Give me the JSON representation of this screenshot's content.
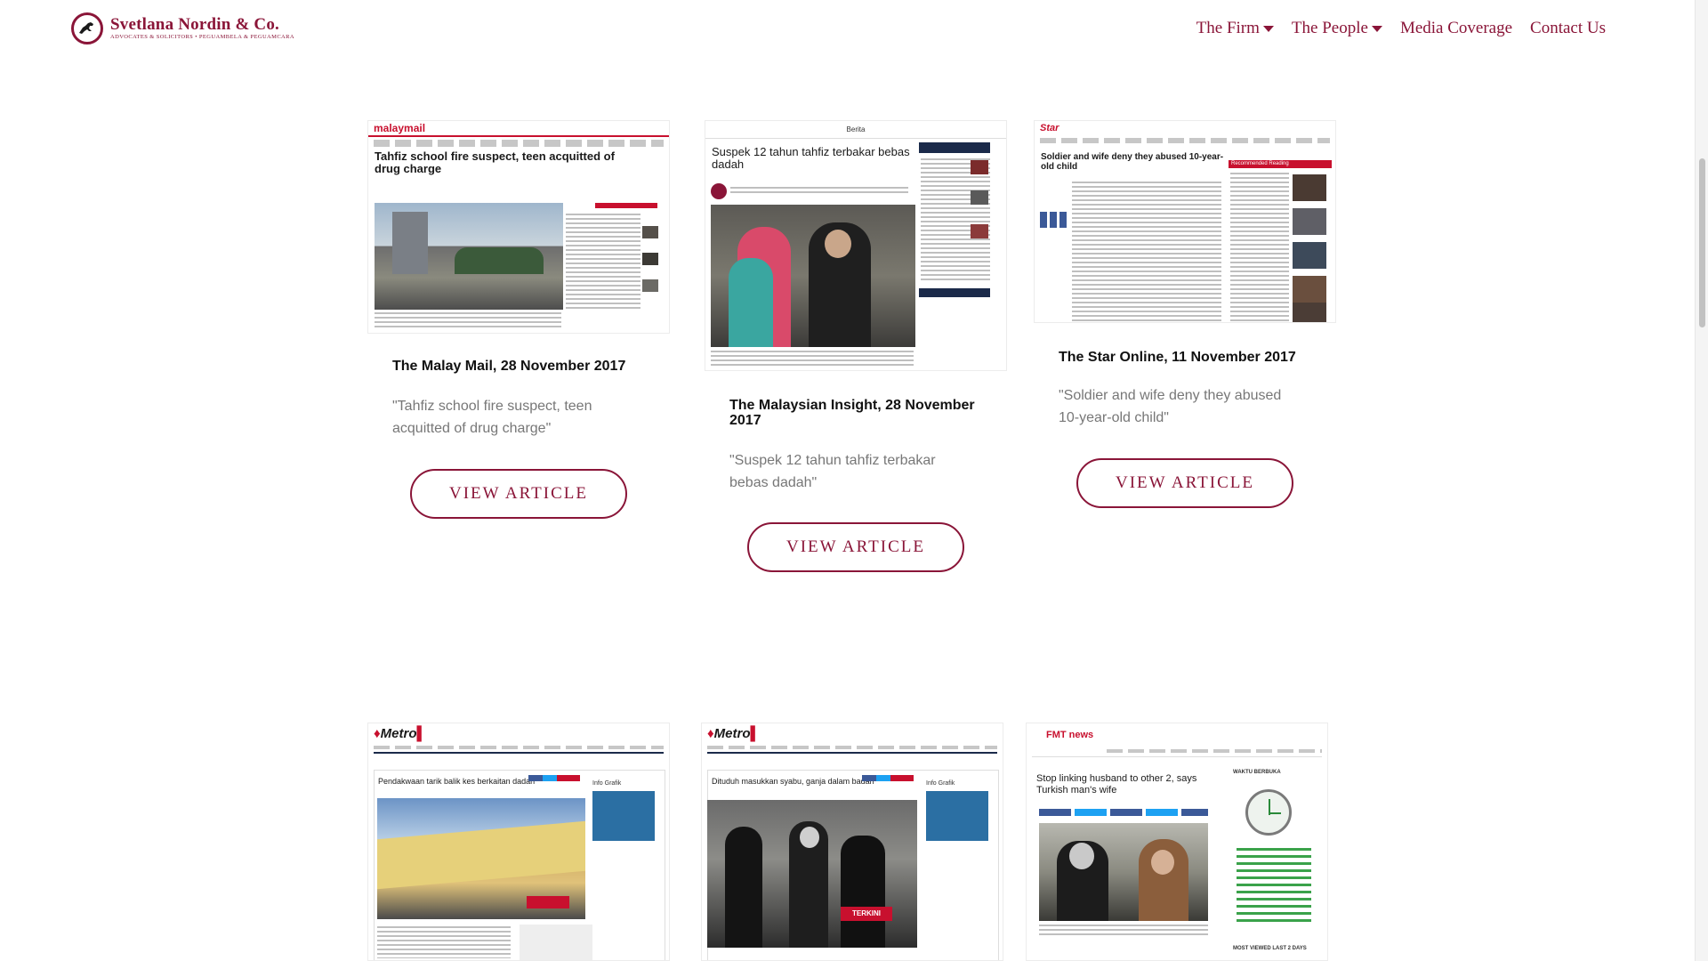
{
  "header": {
    "logo": {
      "name": "Svetlana Nordin & Co.",
      "subtitle": "ADVOCATES & SOLICITORS • PEGUAMBELA & PEGUAMCARA"
    },
    "nav": [
      {
        "label": "The Firm",
        "has_dropdown": true
      },
      {
        "label": "The People",
        "has_dropdown": true
      },
      {
        "label": "Media Coverage",
        "has_dropdown": false
      },
      {
        "label": "Contact Us",
        "has_dropdown": false
      }
    ]
  },
  "articles": [
    {
      "source": "The Malay Mail, 28 November 2017",
      "quote": "\"Tahfiz school fire suspect, teen acquitted of drug charge\"",
      "button": "VIEW ARTICLE",
      "thumb": {
        "masthead": "malaymail",
        "headline": "Tahfiz school fire suspect, teen acquitted of drug charge"
      }
    },
    {
      "source": "The Malaysian Insight, 28 November 2017",
      "quote": "\"Suspek 12 tahun tahfiz terbakar bebas dadah\"",
      "button": "VIEW ARTICLE",
      "thumb": {
        "masthead": "Berita",
        "headline": "Suspek 12 tahun tahfiz terbakar bebas dadah"
      }
    },
    {
      "source": "The Star Online, 11 November 2017",
      "quote": "\"Soldier and wife deny they abused 10-year-old child\"",
      "button": "VIEW ARTICLE",
      "thumb": {
        "masthead": "Star",
        "headline": "Soldier and wife deny they abused 10-year-old child",
        "sidebar": "Recommended Reading"
      }
    },
    {
      "thumb": {
        "masthead": "Metro",
        "headline": "Pendakwaan tarik balik kes berkaitan dadah",
        "sidebar": "Info Grafik"
      }
    },
    {
      "thumb": {
        "masthead": "Metro",
        "headline": "Dituduh masukkan syabu, ganja dalam badan",
        "sidebar": "Info Grafik",
        "badge": "TERKINI"
      }
    },
    {
      "thumb": {
        "masthead": "FMT news",
        "headline": "Stop linking husband to other 2, says Turkish man's wife",
        "sidebar": "WAKTU BERBUKA",
        "footer": "MOST VIEWED LAST 2 DAYS"
      }
    }
  ],
  "colors": {
    "brand": "#8a1538",
    "text": "#111111",
    "muted": "#777777"
  }
}
